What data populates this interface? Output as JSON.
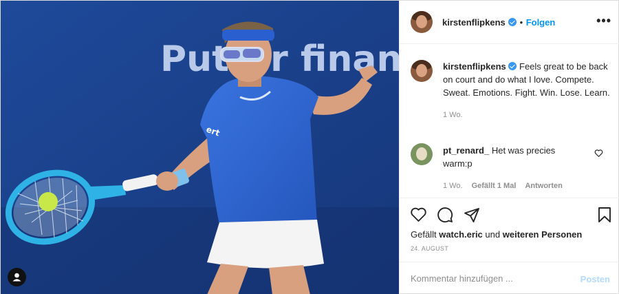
{
  "photo": {
    "banner_text": "Putter financ",
    "sponsor_text": "ert",
    "description_icon": "user-tag-icon"
  },
  "header": {
    "username": "kirstenflipkens",
    "separator": "•",
    "follow_label": "Folgen",
    "more_icon": "more-options-icon",
    "more_glyph": "•••"
  },
  "caption": {
    "username": "kirstenflipkens",
    "text": "Feels great to be back on court and do what I love. Compete. Sweat. Emotions. Fight. Win. Lose. Learn.",
    "age": "1 Wo."
  },
  "comments": [
    {
      "username": "pt_renard_",
      "text": "Het was precies warm:p",
      "age": "1 Wo.",
      "likes": "Gefällt 1 Mal",
      "reply_label": "Antworten"
    }
  ],
  "actions": {
    "likes_prefix": "Gefällt",
    "likes_user": "watch.eric",
    "likes_mid": "und",
    "likes_suffix": "weiteren Personen",
    "date": "24. AUGUST"
  },
  "comment_form": {
    "placeholder": "Kommentar hinzufügen ...",
    "post_label": "Posten"
  },
  "colors": {
    "accent": "#0095f6",
    "verified": "#3897f0",
    "muted": "#8e8e8e"
  }
}
